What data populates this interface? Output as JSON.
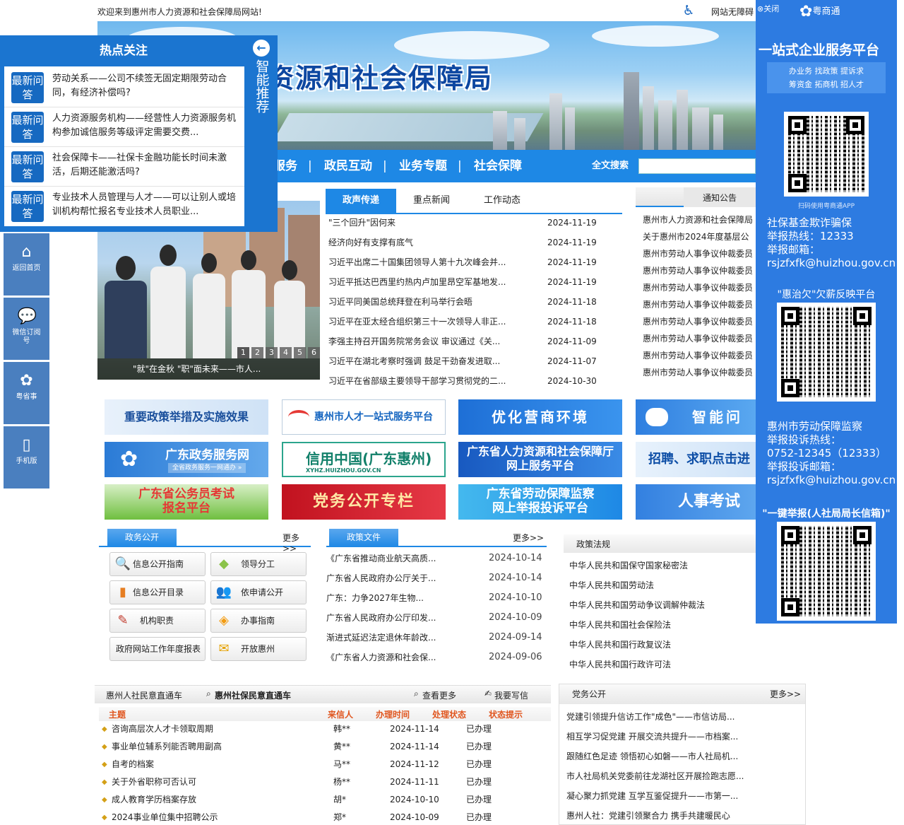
{
  "header": {
    "welcome": "欢迎来到惠州市人力资源和社会保障局网站!",
    "accessibility": "网站无障碍"
  },
  "banner": {
    "title": "资源和社会保障局"
  },
  "nav": {
    "items": [
      "政务服务",
      "政民互动",
      "业务专题",
      "社会保障"
    ],
    "search_label": "全文搜索",
    "search_value": ""
  },
  "hot": {
    "title": "热点关注",
    "badge": "最新问答",
    "items": [
      "劳动关系——公司不续签无固定期限劳动合同，有经济补偿吗?",
      "人力资源服务机构——经营性人力资源服务机构参加诚信服务等级评定需要交费...",
      "社会保障卡——社保卡金融功能长时间未激活，后期还能激活吗?",
      "专业技术人员管理与人才——可以让别人或培训机构帮忙报名专业技术人员职业..."
    ],
    "smart": "智能推荐"
  },
  "side": [
    {
      "icon": "home-icon",
      "label": "返回首页"
    },
    {
      "icon": "wechat-icon",
      "label": "微信订阅号"
    },
    {
      "icon": "yueshangtong-icon",
      "label": "粤省事"
    },
    {
      "icon": "mobile-icon",
      "label": "手机版"
    }
  ],
  "slideshow": {
    "caption": "\"就\"在金秋 \"职\"面未来——市人...",
    "pages": [
      "1",
      "2",
      "3",
      "4",
      "5",
      "6"
    ]
  },
  "news": {
    "tabs": [
      "政声传递",
      "重点新闻",
      "工作动态"
    ],
    "rows": [
      {
        "title": "\"三个回升\"因何来",
        "date": "2024-11-19"
      },
      {
        "title": "经济向好有支撑有底气",
        "date": "2024-11-19"
      },
      {
        "title": "习近平出席二十国集团领导人第十九次峰会并...",
        "date": "2024-11-19"
      },
      {
        "title": "习近平抵达巴西里约热内卢加里昂空军基地发...",
        "date": "2024-11-19"
      },
      {
        "title": "习近平同美国总统拜登在利马举行会晤",
        "date": "2024-11-18"
      },
      {
        "title": "习近平在亚太经合组织第三十一次领导人非正...",
        "date": "2024-11-18"
      },
      {
        "title": "李强主持召开国务院常务会议 审议通过《关...",
        "date": "2024-11-09"
      },
      {
        "title": "习近平在湖北考察时强调 鼓足干劲奋发进取...",
        "date": "2024-11-07"
      },
      {
        "title": "习近平在省部级主要领导干部学习贯彻党的二...",
        "date": "2024-10-30"
      }
    ]
  },
  "notice": {
    "tab": "通知公告",
    "rows": [
      "惠州市人力资源和社会保障局",
      "关于惠州市2024年度基层公",
      "惠州市劳动人事争议仲裁委员",
      "惠州市劳动人事争议仲裁委员",
      "惠州市劳动人事争议仲裁委员",
      "惠州市劳动人事争议仲裁委员",
      "惠州市劳动人事争议仲裁委员",
      "惠州市劳动人事争议仲裁委员",
      "惠州市劳动人事争议仲裁委员",
      "惠州市劳动人事争议仲裁委员"
    ]
  },
  "promos": [
    "重要政策举措及实施效果",
    "惠州市人才一站式服务平台",
    "优化营商环境",
    "智能问",
    "广东政务服务网",
    "全省政务服务一网通办 »",
    "信用中国(广东惠州)",
    "XYHZ.HUIZHOU.GOV.CN",
    "广东省人力资源和社会保障厅",
    "网上服务平台",
    "招聘、求职点击进",
    "广东省公务员考试",
    "报名平台",
    "党务公开专栏",
    "广东省劳动保障监察",
    "网上举报投诉平台",
    "人事考试"
  ],
  "gk": {
    "tab": "政务公开",
    "more": "更多>>",
    "buttons": [
      {
        "icon": "magnifier-icon",
        "label": "信息公开指南"
      },
      {
        "icon": "leader-icon",
        "label": "领导分工"
      },
      {
        "icon": "book-icon",
        "label": "信息公开目录"
      },
      {
        "icon": "people-icon",
        "label": "依申请公开"
      },
      {
        "icon": "pen-icon",
        "label": "机构职责"
      },
      {
        "icon": "guide-icon",
        "label": "办事指南"
      },
      {
        "icon": "report-icon",
        "label": "政府网站工作年度报表"
      },
      {
        "icon": "envelope-icon",
        "label": "开放惠州"
      }
    ]
  },
  "policy": {
    "tab": "政策文件",
    "more": "更多>>",
    "rows": [
      {
        "title": "《广东省推动商业航天高质...",
        "date": "2024-10-14"
      },
      {
        "title": "广东省人民政府办公厅关于...",
        "date": "2024-10-14"
      },
      {
        "title": "广东：力争2027年生物...",
        "date": "2024-10-10"
      },
      {
        "title": "广东省人民政府办公厅印发...",
        "date": "2024-10-09"
      },
      {
        "title": "渐进式延迟法定退休年龄改...",
        "date": "2024-09-14"
      },
      {
        "title": "《广东省人力资源和社会保...",
        "date": "2024-09-06"
      }
    ]
  },
  "laws": {
    "title": "政策法规",
    "rows": [
      "中华人民共和国保守国家秘密法",
      "中华人民共和国劳动法",
      "中华人民共和国劳动争议调解仲裁法",
      "中华人民共和国社会保险法",
      "中华人民共和国行政复议法",
      "中华人民共和国行政许可法"
    ]
  },
  "mailbox": {
    "tab1": "惠州人社民意直通车",
    "tab2": "惠州社保民意直通车",
    "view_more": "查看更多",
    "write": "我要写信",
    "cols": [
      "主题",
      "来信人",
      "办理时间",
      "处理状态",
      "状态提示"
    ],
    "rows": [
      {
        "t": "咨询高层次人才卡领取周期",
        "s": "韩**",
        "d": "2024-11-14",
        "st": "已办理"
      },
      {
        "t": "事业单位辅系列能否聘用副高",
        "s": "黄**",
        "d": "2024-11-14",
        "st": "已办理"
      },
      {
        "t": "自考的档案",
        "s": "马**",
        "d": "2024-11-12",
        "st": "已办理"
      },
      {
        "t": "关于外省职称可否认可",
        "s": "杨**",
        "d": "2024-11-11",
        "st": "已办理"
      },
      {
        "t": "成人教育学历档案存放",
        "s": "胡*",
        "d": "2024-10-10",
        "st": "已办理"
      },
      {
        "t": "2024事业单位集中招聘公示",
        "s": "郑*",
        "d": "2024-10-09",
        "st": "已办理"
      }
    ]
  },
  "party": {
    "title": "党务公开",
    "more": "更多>>",
    "rows": [
      "党建引领提升信访工作\"成色\"——市信访局...",
      "相互学习促党建 开展交流共提升——市档案...",
      "跟随红色足迹 领悟初心如磐——市人社局机...",
      "市人社局机关党委前往龙湖社区开展捡跑志愿...",
      "凝心聚力抓党建 互学互鉴促提升——市第一...",
      "惠州人社：党建引领聚合力 携手共建暖民心"
    ]
  },
  "right_panel": {
    "close": "关闭",
    "brand": "粤商通",
    "title": "一站式企业服务平台",
    "services1": "办业务  找政策  提诉求",
    "services2": "筹资金  拓商机  招人才",
    "scan": "扫码使用粤商通APP",
    "fund_block": [
      "社保基金欺诈骗保",
      "举报热线：12333",
      "举报邮箱：",
      "rsjzfxfk@huizhou.gov.cn"
    ],
    "wage": "\"惠治欠\"欠薪反映平台",
    "labor_block": [
      "惠州市劳动保障监察",
      "举报投诉热线：",
      "0752-12345（12333）",
      "举报投诉邮箱：",
      "rsjzfxfk@huizhou.gov.cn"
    ],
    "one_key": "\"一键举报(人社局局长信箱)\""
  }
}
